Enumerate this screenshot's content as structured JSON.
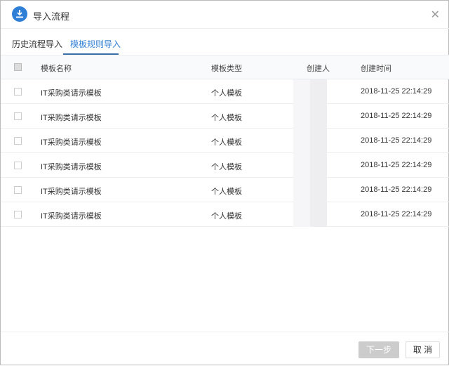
{
  "dialog": {
    "title": "导入流程",
    "close_icon": "close-icon",
    "logo_icon": "download-icon"
  },
  "tabs": [
    {
      "label": "历史流程导入",
      "active": false
    },
    {
      "label": "模板规则导入",
      "active": true
    }
  ],
  "table": {
    "headers": [
      "模板名称",
      "模板类型",
      "创建人",
      "创建时间"
    ],
    "rows": [
      {
        "name": "IT采购类请示模板",
        "type": "个人模板",
        "time": "2018-11-25 22:14:29"
      },
      {
        "name": "IT采购类请示模板",
        "type": "个人模板",
        "time": "2018-11-25 22:14:29"
      },
      {
        "name": "IT采购类请示模板",
        "type": "个人模板",
        "time": "2018-11-25 22:14:29"
      },
      {
        "name": "IT采购类请示模板",
        "type": "个人模板",
        "time": "2018-11-25 22:14:29"
      },
      {
        "name": "IT采购类请示模板",
        "type": "个人模板",
        "time": "2018-11-25 22:14:29"
      },
      {
        "name": "IT采购类请示模板",
        "type": "个人模板",
        "time": "2018-11-25 22:14:29"
      }
    ]
  },
  "footer": {
    "next_label": "下一步",
    "cancel_label": "取 消"
  },
  "colors": {
    "accent": "#2f7fd6"
  }
}
